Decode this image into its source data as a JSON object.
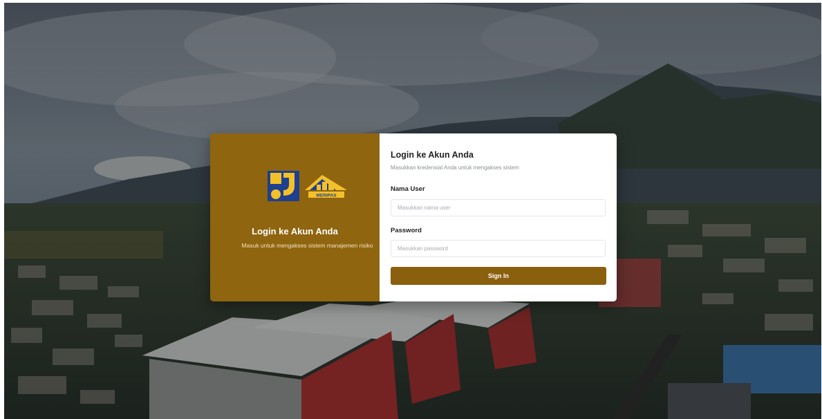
{
  "brand": {
    "colors": {
      "panel": "#8f650f",
      "button": "#8a5f0d",
      "logo_blue": "#1f3f8f",
      "logo_yellow": "#f4c02a"
    },
    "logos": [
      "pu-logo-icon",
      "meripas-logo-icon"
    ],
    "logo_text": "MERIPAS"
  },
  "left_panel": {
    "title": "Login ke Akun Anda",
    "subtitle": "Masuk untuk mengakses sistem manajemen risiko"
  },
  "form": {
    "title": "Login ke Akun Anda",
    "subtitle": "Masukkan kredensial Anda untuk mengakses sistem",
    "username": {
      "label": "Nama User",
      "placeholder": "Masukkan nama user",
      "value": ""
    },
    "password": {
      "label": "Password",
      "placeholder": "Masukkan password",
      "value": ""
    },
    "submit_label": "Sign In"
  }
}
